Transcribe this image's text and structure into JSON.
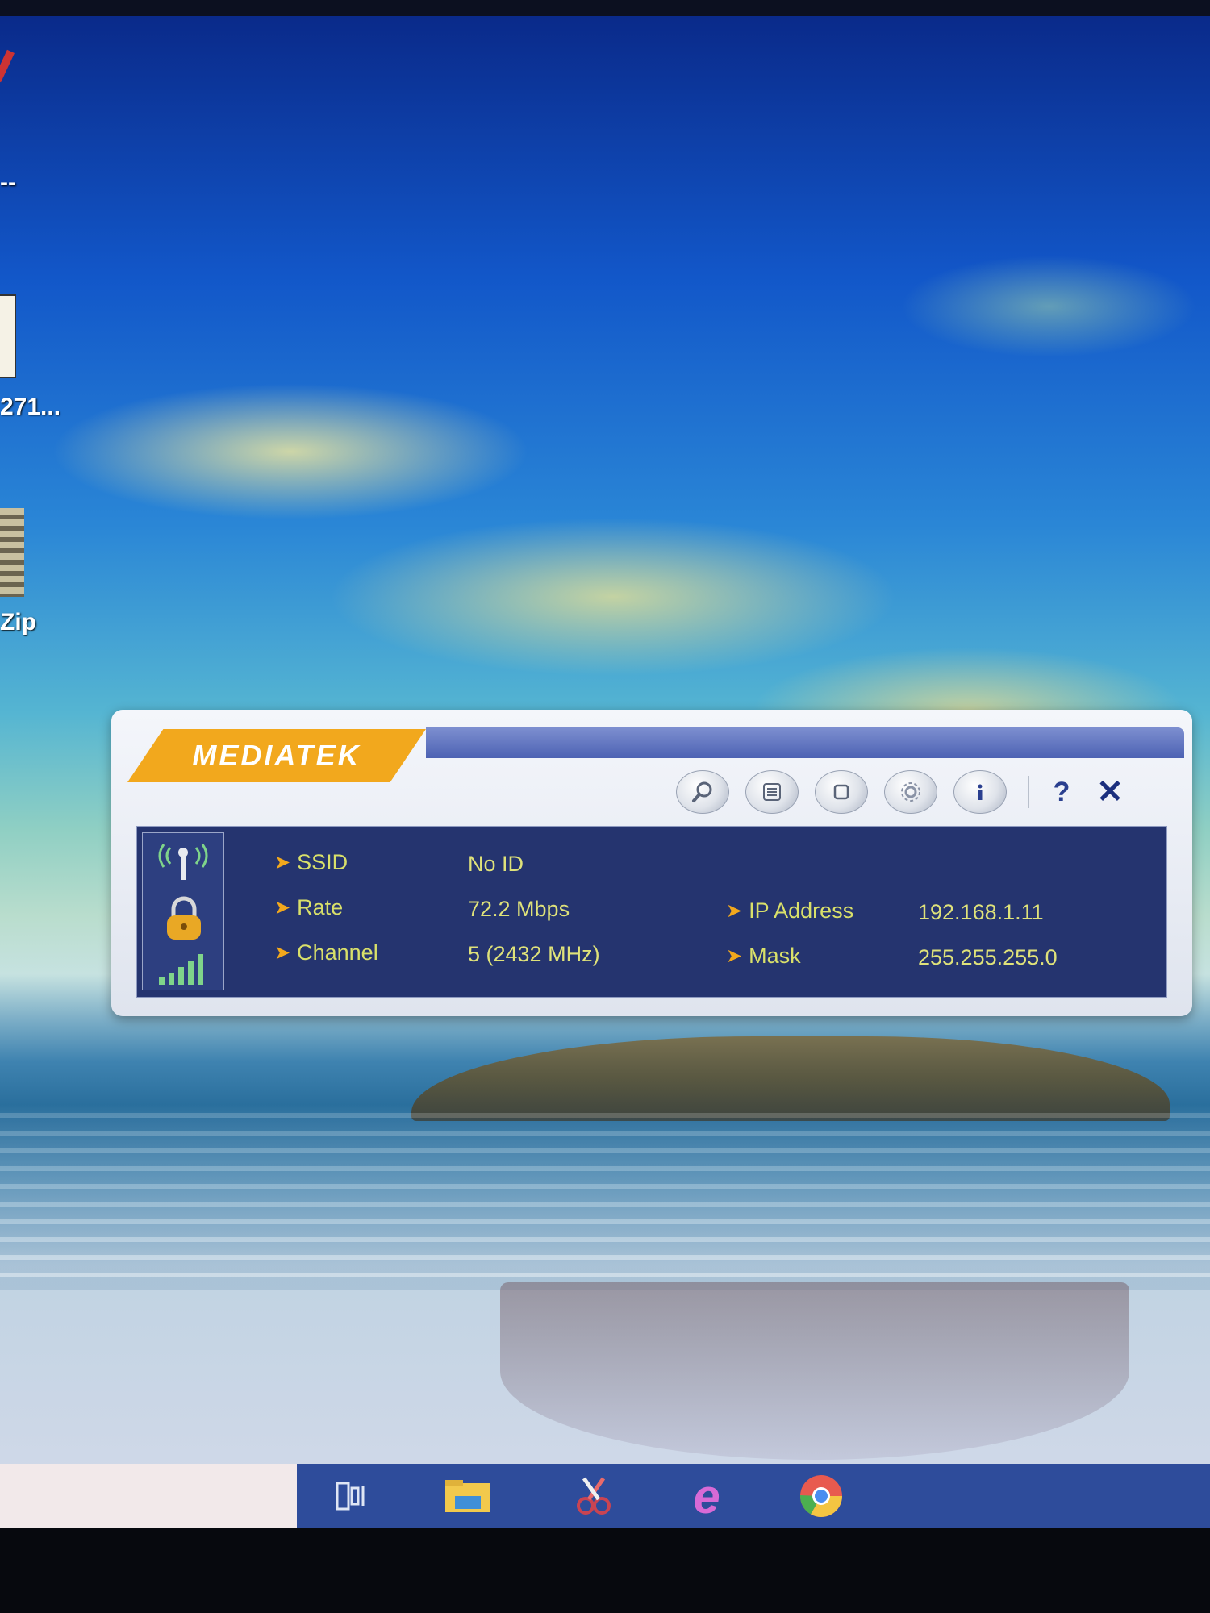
{
  "desktop": {
    "icons": [
      {
        "label": "--"
      },
      {
        "label": "271..."
      },
      {
        "label": "Zip"
      }
    ]
  },
  "mediatek": {
    "logo": "MEDIATEK",
    "toolbar": {
      "buttons": [
        {
          "icon": "magnifier-icon"
        },
        {
          "icon": "list-icon"
        },
        {
          "icon": "window-icon"
        },
        {
          "icon": "gear-icon"
        },
        {
          "icon": "info-icon",
          "label": "i"
        }
      ],
      "help_label": "?",
      "close_label": "✕"
    },
    "fields": {
      "ssid_label": "SSID",
      "ssid_value": "No ID",
      "rate_label": "Rate",
      "rate_value": "72.2 Mbps",
      "channel_label": "Channel",
      "channel_value": "5 (2432 MHz)",
      "ip_label": "IP Address",
      "ip_value": "192.168.1.11",
      "mask_label": "Mask",
      "mask_value": "255.255.255.0"
    },
    "status_icons": [
      "wifi-antenna-icon",
      "lock-icon",
      "signal-strength-icon"
    ]
  },
  "taskbar": {
    "apps": [
      {
        "icon": "task-view-icon"
      },
      {
        "icon": "file-explorer-icon"
      },
      {
        "icon": "snipping-tool-icon"
      },
      {
        "icon": "edge-icon",
        "label": "e"
      },
      {
        "icon": "chrome-icon"
      }
    ]
  },
  "colors": {
    "brand_orange": "#f2a81d",
    "panel_navy": "#25346f",
    "label_yellow": "#d9e06a",
    "taskbar_blue": "#2e4c9b"
  }
}
